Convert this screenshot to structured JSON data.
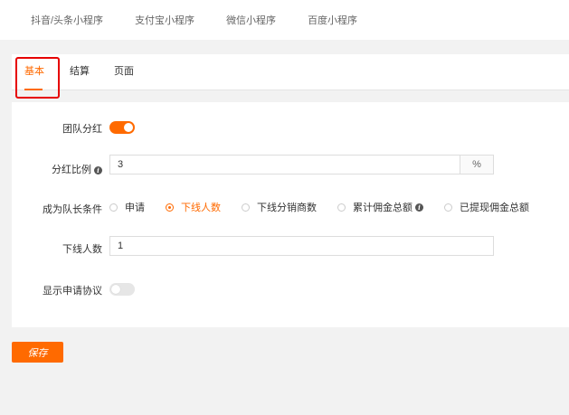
{
  "top_nav": {
    "items": [
      "抖音/头条小程序",
      "支付宝小程序",
      "微信小程序",
      "百度小程序"
    ]
  },
  "tabs": [
    {
      "label": "基本",
      "active": true
    },
    {
      "label": "结算",
      "active": false
    },
    {
      "label": "页面",
      "active": false
    }
  ],
  "form": {
    "team_dividend": {
      "label": "团队分红",
      "enabled": true
    },
    "dividend_ratio": {
      "label": "分红比例",
      "value": "3",
      "unit": "%"
    },
    "leader_condition": {
      "label": "成为队长条件",
      "options": [
        "申请",
        "下线人数",
        "下线分销商数",
        "累计佣金总额",
        "已提现佣金总额"
      ],
      "selected": "下线人数"
    },
    "downline_count": {
      "label": "下线人数",
      "value": "1"
    },
    "show_agreement": {
      "label": "显示申请协议",
      "enabled": false
    }
  },
  "actions": {
    "save_label": "保存"
  },
  "colors": {
    "accent": "#ff6a00",
    "highlight_box": "#e60000"
  }
}
